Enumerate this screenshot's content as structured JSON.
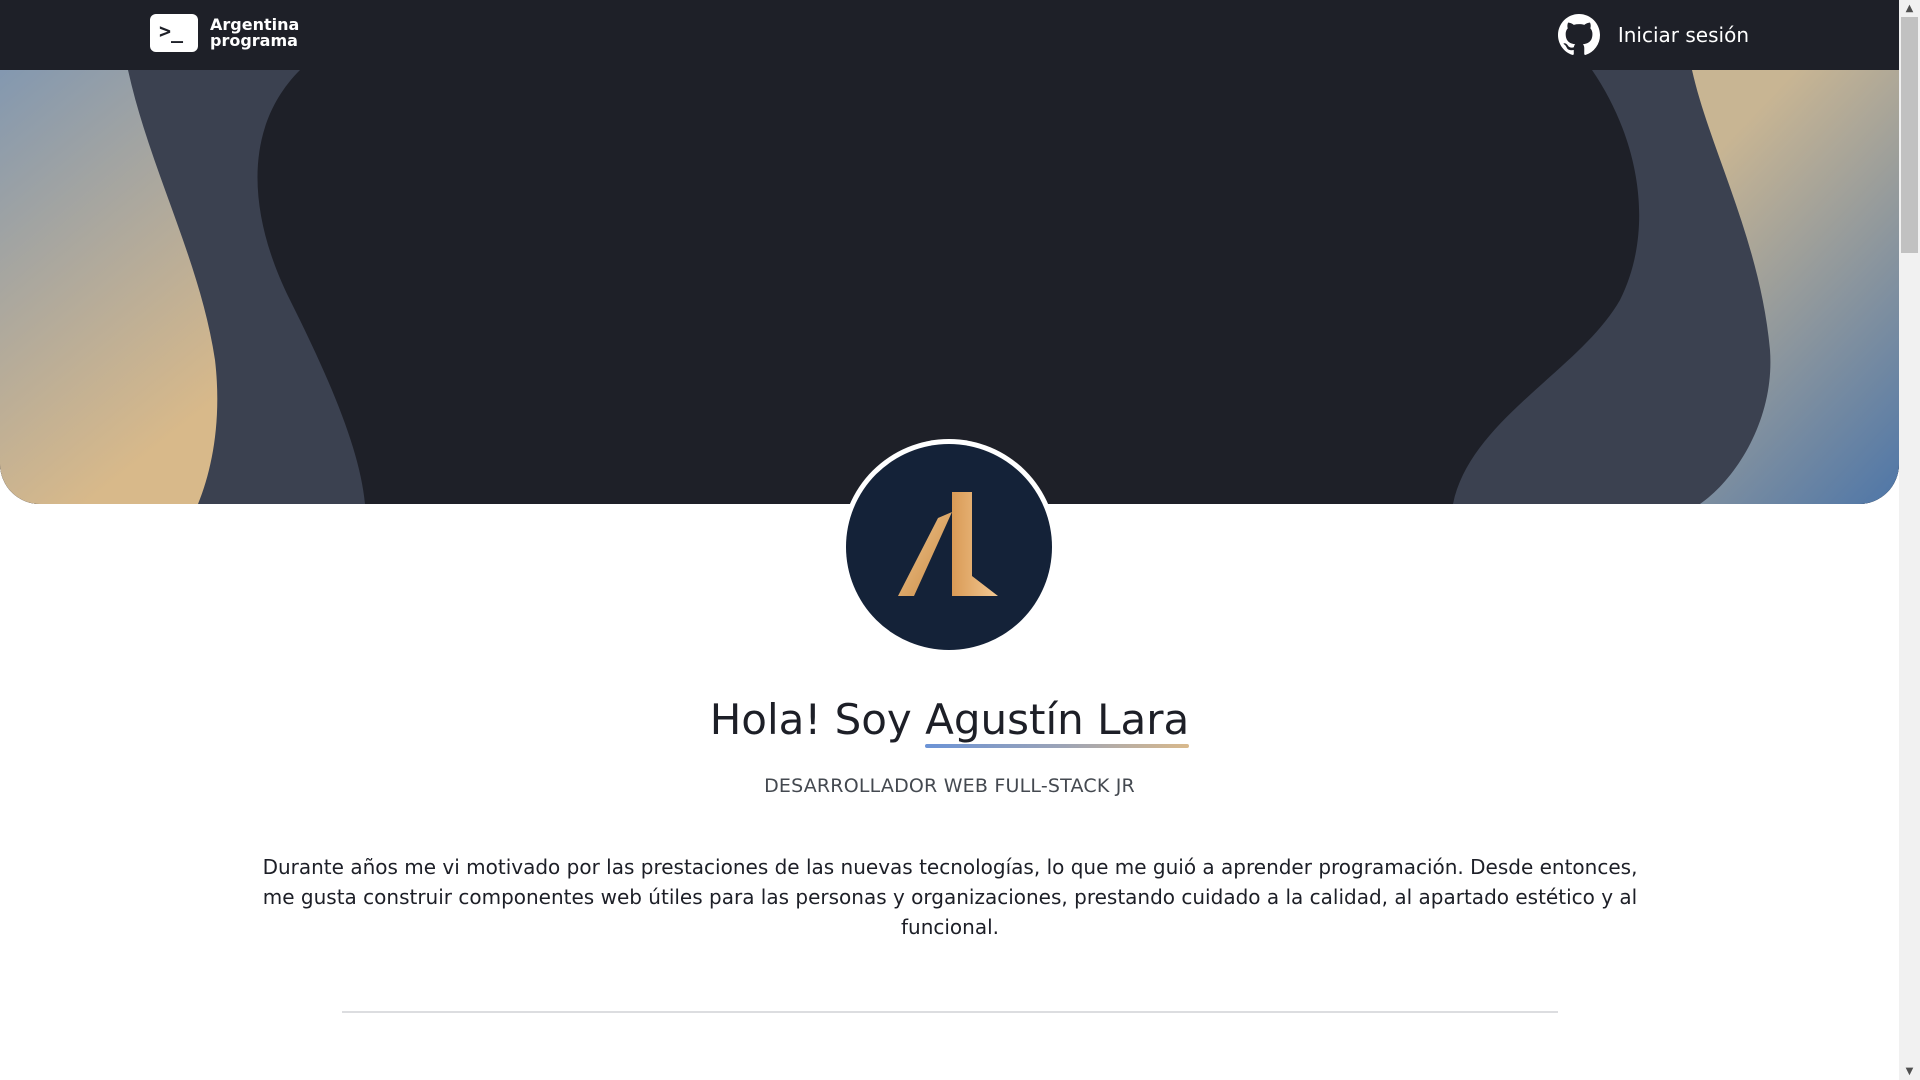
{
  "navbar": {
    "brand": {
      "line1": "Argentina",
      "line2": "programa",
      "prompt_glyph": ">_"
    },
    "login": {
      "label": "Iniciar sesión",
      "icon": "github-icon"
    }
  },
  "hero": {
    "colors": {
      "background": "#1e2028",
      "wave": "#3b4150",
      "gradient_left_top": "#8398b0",
      "gradient_left_bottom": "#d8b98a",
      "gradient_right_top": "#c8b593",
      "gradient_right_bottom": "#4e76a8"
    }
  },
  "profile": {
    "avatar": {
      "monogram": "AL",
      "background": "#142238",
      "accent": "#e0a665"
    },
    "greeting": "Hola! Soy",
    "name": "Agustín Lara",
    "role": "DESARROLLADOR WEB FULL-STACK JR",
    "bio": "Durante años me vi motivado por las prestaciones de las nuevas tecnologías, lo que me guió a aprender programación. Desde entonces, me gusta construir componentes web útiles para las personas y organizaciones, prestando cuidado a la calidad, al apartado estético y al funcional."
  }
}
